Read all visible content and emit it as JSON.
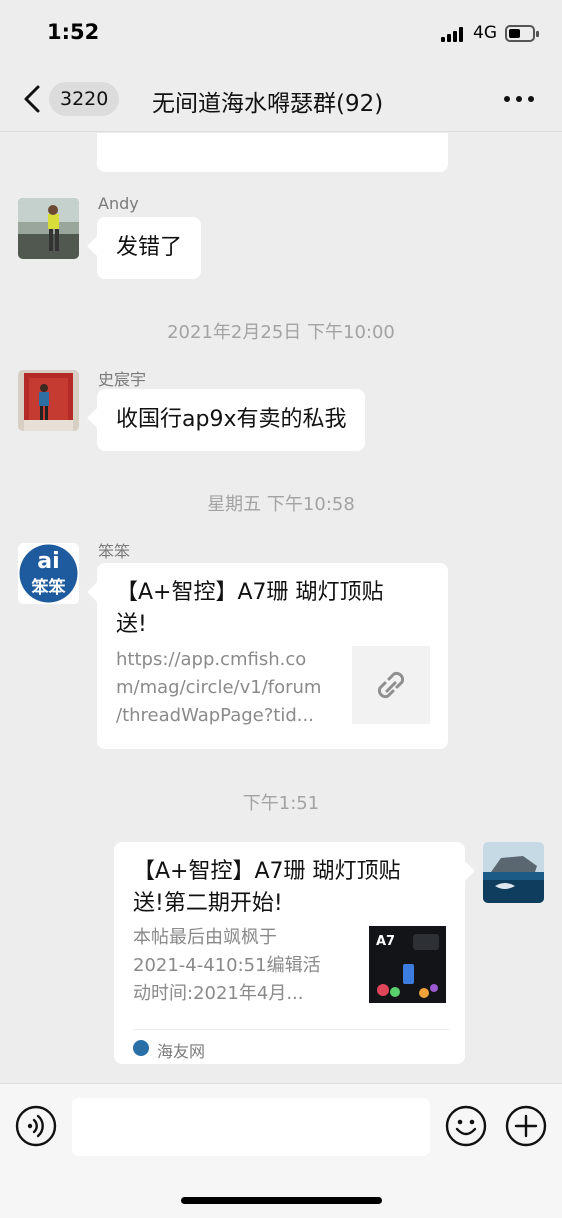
{
  "status_bar": {
    "time": "1:52",
    "network": "4G"
  },
  "nav": {
    "back_count": "3220",
    "title": "无间道海水嘚瑟群(92)"
  },
  "messages": [
    {
      "sender": "Andy",
      "text": "发错了"
    },
    {
      "timestamp": "2021年2月25日 下午10:00"
    },
    {
      "sender": "史宸宇",
      "text": "收国行ap9x有卖的私我"
    },
    {
      "timestamp": "星期五 下午10:58"
    },
    {
      "sender": "笨笨",
      "avatar_text": "笨笨",
      "title_line1": "【A+智控】A7珊 瑚灯顶贴",
      "title_line2": "送!",
      "desc_line1": "https://app.cmfish.co",
      "desc_line2": "m/mag/circle/v1/forum",
      "desc_line3": "/threadWapPage?tid...",
      "thumb_icon": "link-icon"
    },
    {
      "timestamp": "下午1:51"
    },
    {
      "side": "self",
      "title_line1": "【A+智控】A7珊 瑚灯顶贴",
      "title_line2": "送!第二期开始!",
      "desc_line1": "本帖最后由飒枫于",
      "desc_line2": "2021-4-410:51编辑活",
      "desc_line3": "动时间:2021年4月...",
      "thumb_text": "A7",
      "source": "海友网"
    }
  ],
  "input_bar": {
    "placeholder": ""
  },
  "colors": {
    "background": "#ededed",
    "bubble": "#ffffff",
    "timestamp": "#a3a3a3",
    "link_thumb": "#f2f2f2"
  }
}
